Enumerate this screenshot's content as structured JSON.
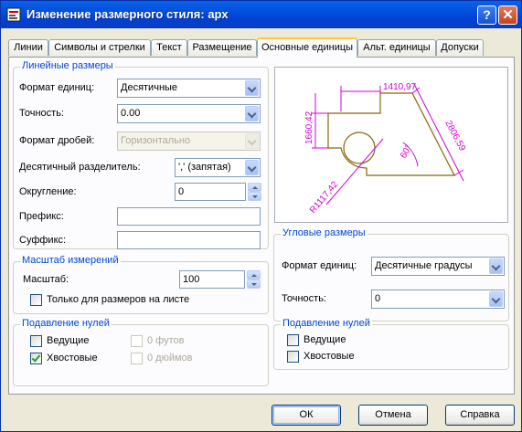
{
  "window": {
    "title": "Изменение размерного стиля: арх",
    "help_btn": "?",
    "close_btn": "✕"
  },
  "tabs": [
    "Линии",
    "Символы и стрелки",
    "Текст",
    "Размещение",
    "Основные единицы",
    "Альт. единицы",
    "Допуски"
  ],
  "active_tab": "Основные единицы",
  "linear": {
    "legend": "Линейные размеры",
    "format_label": "Формат единиц:",
    "format_value": "Десятичные",
    "precision_label": "Точность:",
    "precision_value": "0.00",
    "fraction_label": "Формат дробей:",
    "fraction_value": "Горизонтально",
    "decimal_label": "Десятичный разделитель:",
    "decimal_value": "',' (запятая)",
    "round_label": "Округление:",
    "round_value": "0",
    "prefix_label": "Префикс:",
    "prefix_value": "",
    "suffix_label": "Суффикс:",
    "suffix_value": ""
  },
  "scale": {
    "legend": "Масштаб измерений",
    "scale_label": "Масштаб:",
    "scale_value": "100",
    "layout_only_label": "Только для размеров на листе",
    "layout_only_checked": false
  },
  "zero_linear": {
    "legend": "Подавление нулей",
    "leading": "Ведущие",
    "leading_checked": false,
    "trailing": "Хвостовые",
    "trailing_checked": true,
    "feet": "0 футов",
    "inches": "0 дюймов"
  },
  "preview": {
    "dim_top": "1410,97",
    "dim_left": "1660,42",
    "dim_right": "2806,59",
    "dim_angle": "60°",
    "dim_radius": "R1117,42",
    "line_color": "#d400d4",
    "shape_color": "#8b6508"
  },
  "angular": {
    "legend": "Угловые размеры",
    "format_label": "Формат единиц:",
    "format_value": "Десятичные градусы",
    "precision_label": "Точность:",
    "precision_value": "0"
  },
  "zero_angular": {
    "legend": "Подавление нулей",
    "leading": "Ведущие",
    "leading_checked": false,
    "trailing": "Хвостовые",
    "trailing_checked": false
  },
  "buttons": {
    "ok": "ОК",
    "cancel": "Отмена",
    "help": "Справка"
  }
}
